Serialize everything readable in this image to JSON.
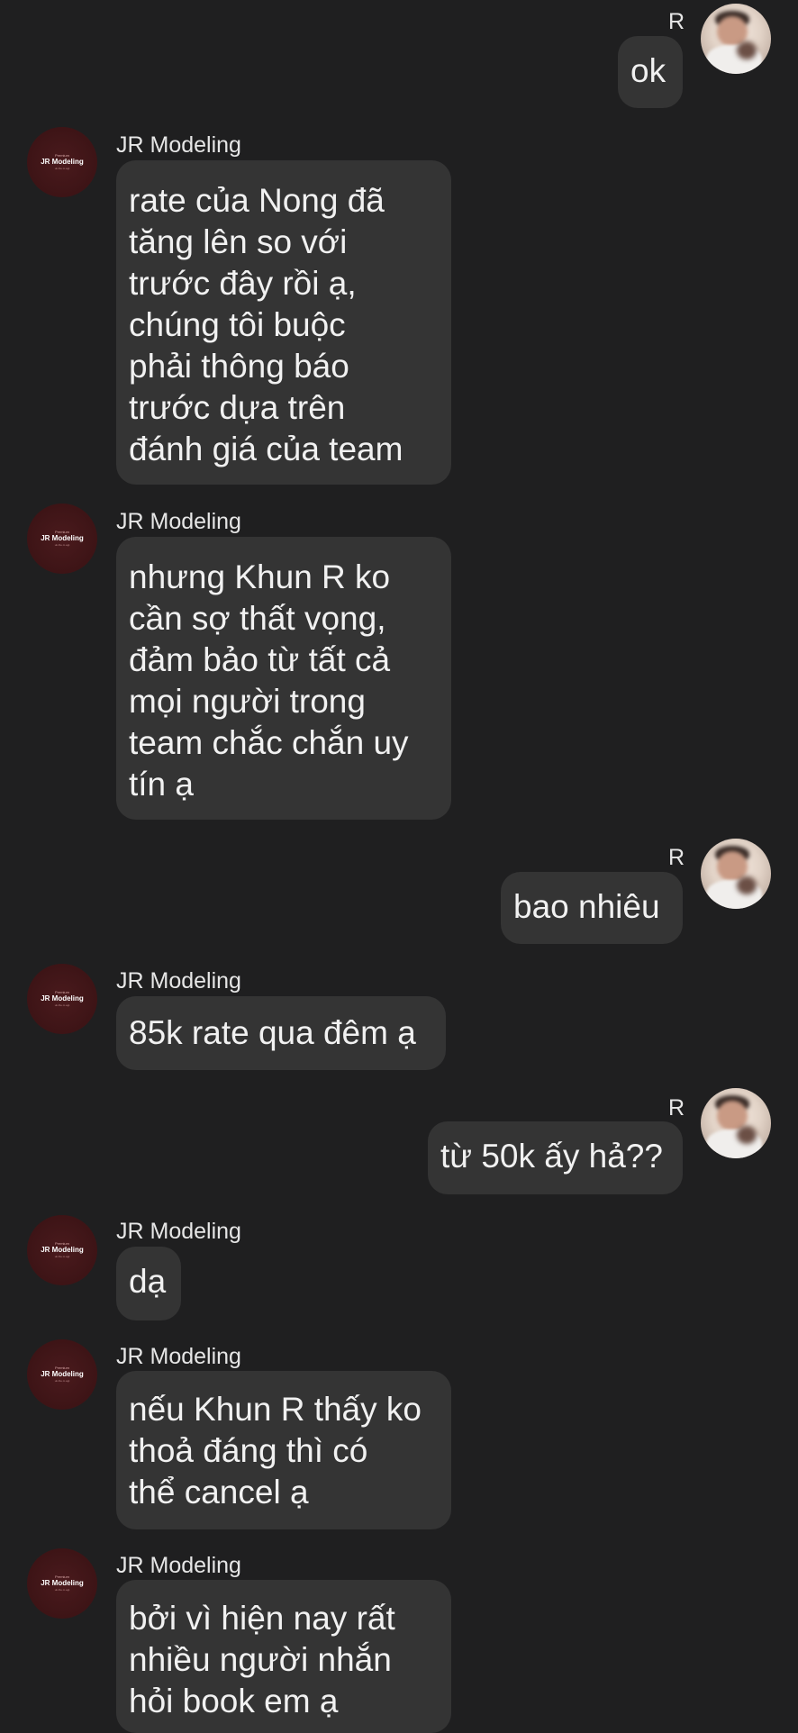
{
  "me": {
    "name": "R"
  },
  "contact": {
    "name": "JR Modeling",
    "avatar_text_top": "Premium",
    "avatar_brand": "JR Modeling",
    "avatar_text_bottom": "uk.the.m.agt"
  },
  "messages": [
    {
      "from": "me",
      "text": "ok"
    },
    {
      "from": "contact",
      "text": "rate của Nong đã\ntăng lên so với\ntrước đây rồi ạ,\nchúng tôi buộc\nphải thông báo\ntrước dựa trên\nđánh giá của team"
    },
    {
      "from": "contact",
      "text": "nhưng Khun R ko\ncần sợ thất vọng,\nđảm bảo từ tất cả\nmọi người trong\nteam chắc chắn uy\ntín ạ"
    },
    {
      "from": "me",
      "text": "bao nhiêu"
    },
    {
      "from": "contact",
      "text": "85k rate qua đêm ạ"
    },
    {
      "from": "me",
      "text": "từ 50k ấy hả??"
    },
    {
      "from": "contact",
      "text": "dạ"
    },
    {
      "from": "contact",
      "text": "nếu Khun R thấy ko\nthoả đáng thì có\nthể cancel ạ"
    },
    {
      "from": "contact",
      "text": "bởi vì hiện nay rất\nnhiều người nhắn\nhỏi book em ạ"
    }
  ]
}
